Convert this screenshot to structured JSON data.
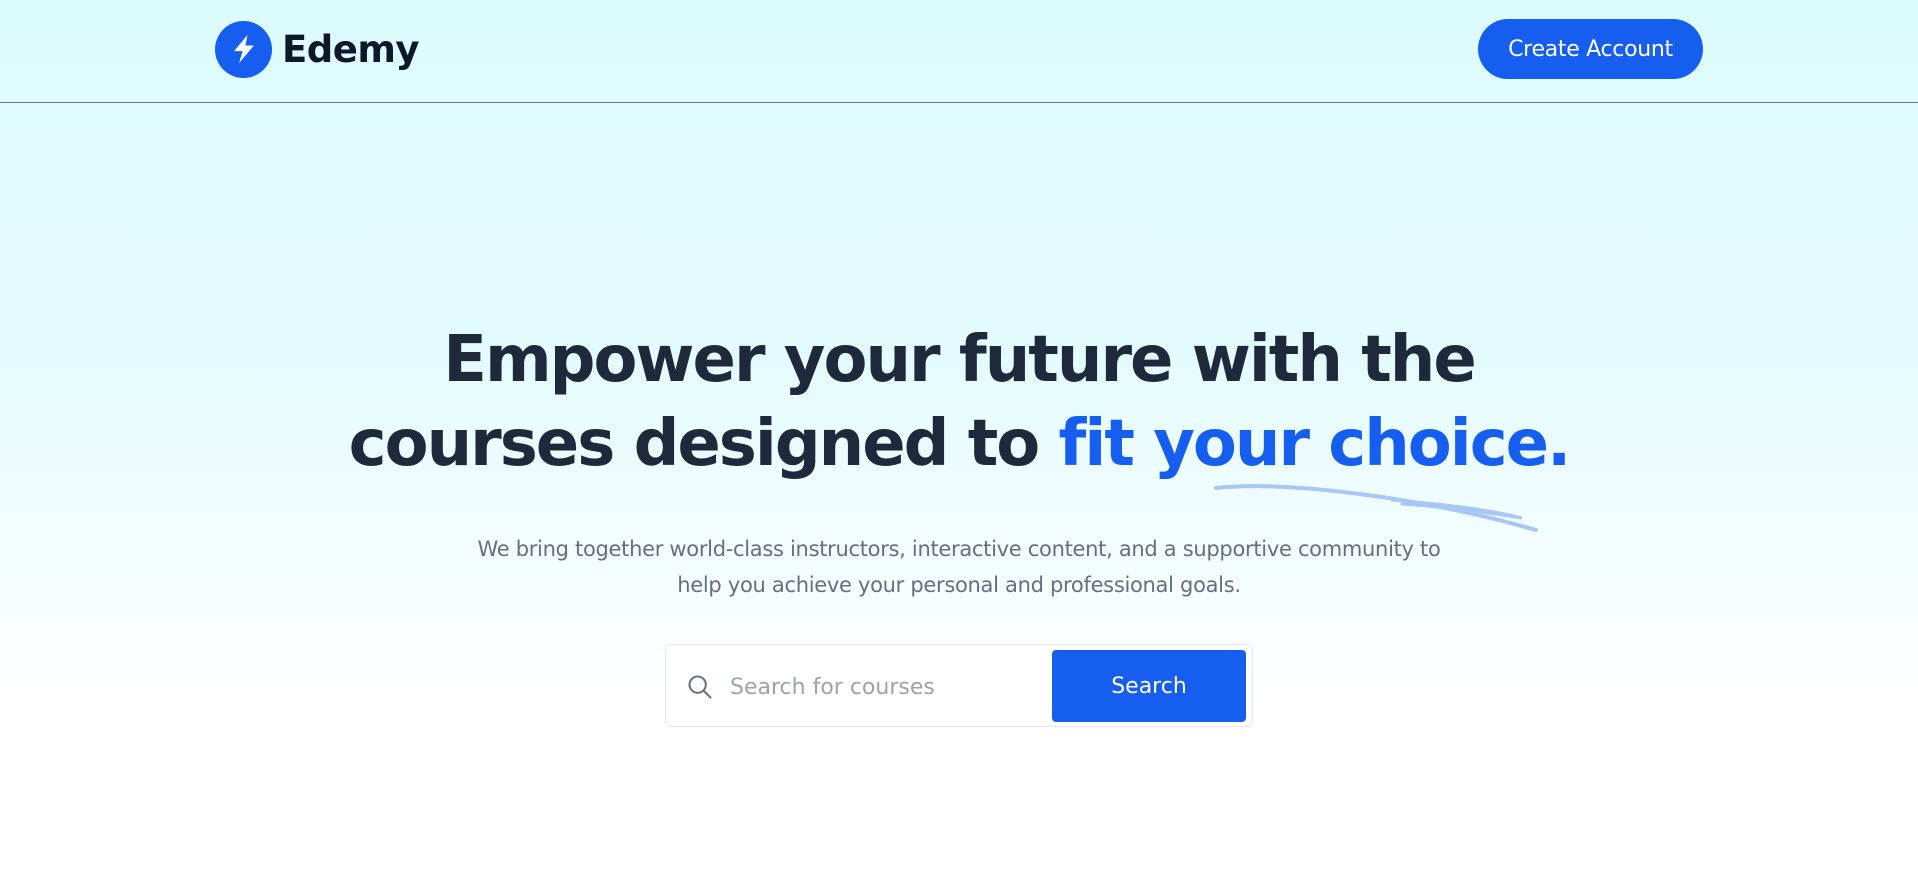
{
  "colors": {
    "brand": "#155eef",
    "heading": "#1e293b",
    "body_text": "#64707f",
    "background_top": "#dcfbfd",
    "background_bottom": "#ffffff"
  },
  "header": {
    "brand_name": "Edemy",
    "logo_icon": "lightning-bolt-icon",
    "create_account_label": "Create Account"
  },
  "hero": {
    "title_part1": "Empower your future with the",
    "title_part2": "courses designed to ",
    "title_accent": "fit your choice.",
    "subtitle_line1": "We bring together world-class instructors, interactive content, and a supportive community to",
    "subtitle_line2": "help you achieve your personal and professional goals."
  },
  "search": {
    "icon": "search-icon",
    "placeholder": "Search for courses",
    "value": "",
    "button_label": "Search"
  }
}
